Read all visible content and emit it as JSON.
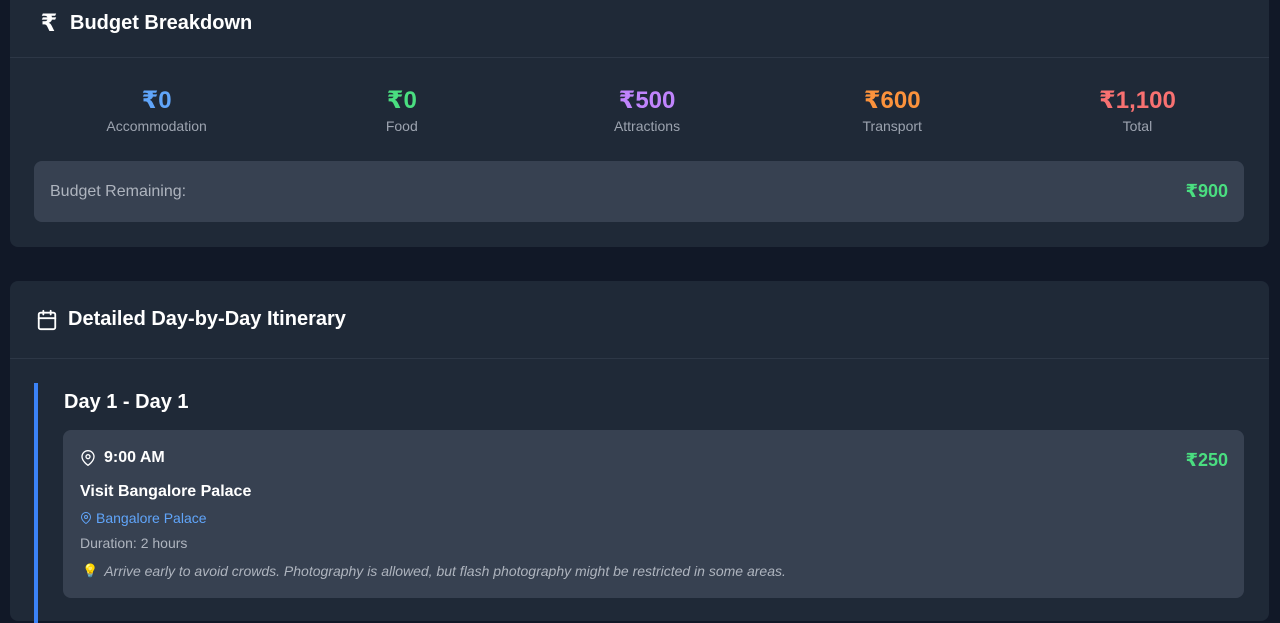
{
  "budget": {
    "title": "Budget Breakdown",
    "header_icon": "rupee-icon",
    "stats": [
      {
        "value": "₹0",
        "label": "Accommodation",
        "color": "#60a5fa"
      },
      {
        "value": "₹0",
        "label": "Food",
        "color": "#4ade80"
      },
      {
        "value": "₹500",
        "label": "Attractions",
        "color": "#c084fc"
      },
      {
        "value": "₹600",
        "label": "Transport",
        "color": "#fb923c"
      },
      {
        "value": "₹1,100",
        "label": "Total",
        "color": "#f87171"
      }
    ],
    "remaining_label": "Budget Remaining:",
    "remaining_value": "₹900"
  },
  "itinerary": {
    "title": "Detailed Day-by-Day Itinerary",
    "header_icon": "calendar-icon",
    "days": [
      {
        "title": "Day 1 - Day 1",
        "activities": [
          {
            "time": "9:00 AM",
            "cost": "₹250",
            "title": "Visit Bangalore Palace",
            "location": "Bangalore Palace",
            "duration": "Duration: 2 hours",
            "tip_icon": "lightbulb-icon",
            "tip": "Arrive early to avoid crowds. Photography is allowed, but flash photography might be restricted in some areas."
          }
        ]
      }
    ]
  }
}
